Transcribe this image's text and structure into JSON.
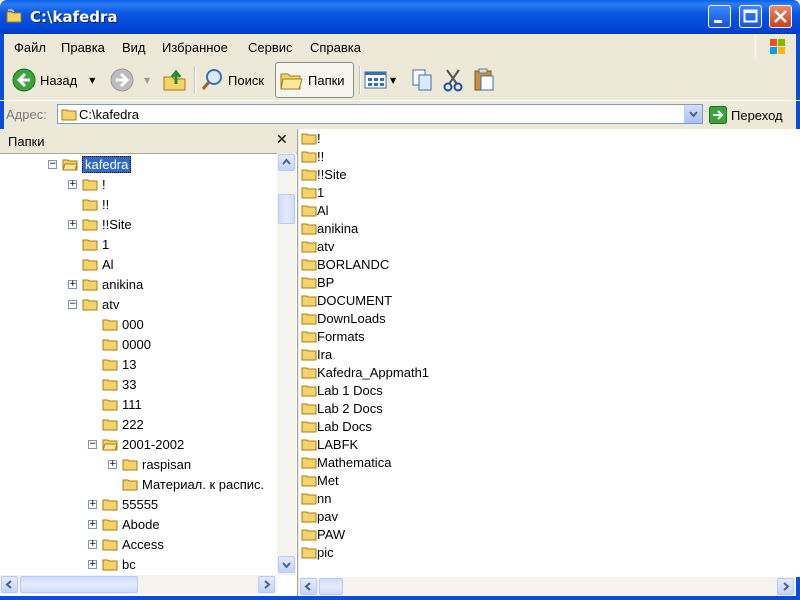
{
  "window": {
    "title": "C:\\kafedra"
  },
  "menu": [
    "Файл",
    "Правка",
    "Вид",
    "Избранное",
    "Сервис",
    "Справка"
  ],
  "toolbar": {
    "back": "Назад",
    "search": "Поиск",
    "folders": "Папки"
  },
  "address": {
    "label": "Адрес:",
    "value": "C:\\kafedra",
    "go": "Переход"
  },
  "left_pane": {
    "title": "Папки"
  },
  "tree": [
    {
      "label": "kafedra",
      "expander": "minus",
      "selected": true,
      "open": true
    },
    {
      "label": "!",
      "expander": "plus"
    },
    {
      "label": "!!",
      "expander": ""
    },
    {
      "label": "!!Site",
      "expander": "plus"
    },
    {
      "label": "1",
      "expander": ""
    },
    {
      "label": "Al",
      "expander": ""
    },
    {
      "label": "anikina",
      "expander": "plus"
    },
    {
      "label": "atv",
      "expander": "minus"
    },
    {
      "label": "000",
      "expander": ""
    },
    {
      "label": "0000",
      "expander": ""
    },
    {
      "label": "13",
      "expander": ""
    },
    {
      "label": "33",
      "expander": ""
    },
    {
      "label": "111",
      "expander": ""
    },
    {
      "label": "222",
      "expander": ""
    },
    {
      "label": "2001-2002",
      "expander": "minus",
      "open": true
    },
    {
      "label": "raspisan",
      "expander": "plus"
    },
    {
      "label": "Материал. к распис.",
      "expander": ""
    },
    {
      "label": "55555",
      "expander": "plus"
    },
    {
      "label": "Abode",
      "expander": "plus"
    },
    {
      "label": "Access",
      "expander": "plus"
    },
    {
      "label": "bc",
      "expander": "plus"
    }
  ],
  "files": [
    "!",
    "!!",
    "!!Site",
    "1",
    "Al",
    "anikina",
    "atv",
    "BORLANDC",
    "BP",
    "DOCUMENT",
    "DownLoads",
    "Formats",
    "Ira",
    "Kafedra_Appmath1",
    "Lab 1 Docs",
    "Lab 2 Docs",
    "Lab Docs",
    "LABFK",
    "Mathematica",
    "Met",
    "nn",
    "pav",
    "PAW",
    "pic"
  ],
  "colors": {
    "titlebar": "#0054e3",
    "selection": "#316ac5",
    "folder": "#f4d36a",
    "chrome": "#ece9d8"
  }
}
